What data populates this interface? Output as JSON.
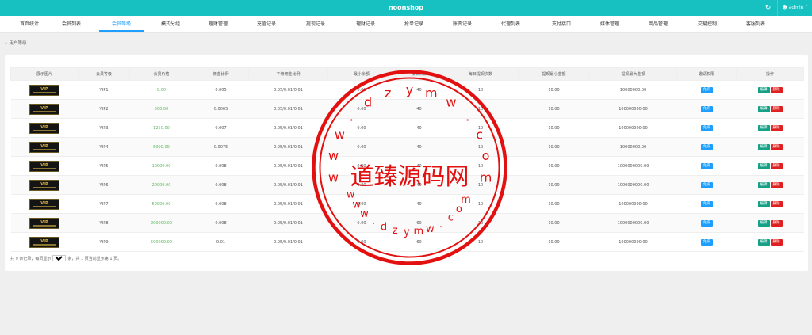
{
  "header": {
    "app_title": "noonshop",
    "refresh_icon": "refresh-icon",
    "user_label": "admin"
  },
  "nav": {
    "items": [
      {
        "label": "首页统计"
      },
      {
        "label": "会员列表"
      },
      {
        "label": "会员等级",
        "active": true
      },
      {
        "label": "模式分组"
      },
      {
        "label": "理财管理"
      },
      {
        "label": "充值记录"
      },
      {
        "label": "提现记录"
      },
      {
        "label": "理财记录"
      },
      {
        "label": "抢单记录"
      },
      {
        "label": "账变记录"
      },
      {
        "label": "代理列表"
      },
      {
        "label": "支付接口"
      },
      {
        "label": "媒体管理"
      },
      {
        "label": "商品管理"
      },
      {
        "label": "交易控制"
      },
      {
        "label": "客服列表"
      }
    ]
  },
  "breadcrumb": {
    "current": "用户等级"
  },
  "table": {
    "columns": [
      "展示图片",
      "会员等级",
      "会员价格",
      "佣金比例",
      "下级佣金比例",
      "最小余额",
      "接单次数",
      "每日提现次数",
      "提现最小金额",
      "提现最大金额",
      "邀请权限",
      "操作"
    ],
    "thumb_text": "VIP",
    "rows": [
      {
        "level": "VIP1",
        "price": "0.00",
        "commission": "0.005",
        "sub_commission": "0.05/0.01/0.01",
        "min_balance": "0.00",
        "orders": "40",
        "daily_withdraw": "10",
        "withdraw_min": "10.00",
        "withdraw_max": "10000000.00"
      },
      {
        "level": "VIP2",
        "price": "500.00",
        "commission": "0.0065",
        "sub_commission": "0.05/0.01/0.01",
        "min_balance": "0.00",
        "orders": "40",
        "daily_withdraw": "10",
        "withdraw_min": "10.00",
        "withdraw_max": "100000000.00"
      },
      {
        "level": "VIP3",
        "price": "1250.00",
        "commission": "0.007",
        "sub_commission": "0.05/0.01/0.01",
        "min_balance": "0.00",
        "orders": "40",
        "daily_withdraw": "10",
        "withdraw_min": "10.00",
        "withdraw_max": "100000000.00"
      },
      {
        "level": "VIP4",
        "price": "5000.00",
        "commission": "0.0075",
        "sub_commission": "0.05/0.01/0.01",
        "min_balance": "0.00",
        "orders": "40",
        "daily_withdraw": "10",
        "withdraw_min": "10.00",
        "withdraw_max": "10000000.00"
      },
      {
        "level": "VIP5",
        "price": "10000.00",
        "commission": "0.008",
        "sub_commission": "0.05/0.01/0.01",
        "min_balance": "0.00",
        "orders": "40",
        "daily_withdraw": "10",
        "withdraw_min": "10.00",
        "withdraw_max": "1000000000.00"
      },
      {
        "level": "VIP6",
        "price": "20000.00",
        "commission": "0.008",
        "sub_commission": "0.05/0.01/0.01",
        "min_balance": "0.00",
        "orders": "40",
        "daily_withdraw": "10",
        "withdraw_min": "10.00",
        "withdraw_max": "1000000000.00"
      },
      {
        "level": "VIP7",
        "price": "50000.00",
        "commission": "0.008",
        "sub_commission": "0.05/0.01/0.01",
        "min_balance": "0.00",
        "orders": "40",
        "daily_withdraw": "10",
        "withdraw_min": "10.00",
        "withdraw_max": "100000000.00"
      },
      {
        "level": "VIP8",
        "price": "200000.00",
        "commission": "0.008",
        "sub_commission": "0.05/0.01/0.01",
        "min_balance": "0.00",
        "orders": "60",
        "daily_withdraw": "10",
        "withdraw_min": "10.00",
        "withdraw_max": "1000000000.00"
      },
      {
        "level": "VIP9",
        "price": "500000.00",
        "commission": "0.01",
        "sub_commission": "0.05/0.01/0.01",
        "min_balance": "0.00",
        "orders": "60",
        "daily_withdraw": "10",
        "withdraw_min": "10.00",
        "withdraw_max": "100000000.00"
      }
    ],
    "invite_label": "允许",
    "edit_label": "编辑",
    "delete_label": "删除"
  },
  "pager": {
    "prefix": "共 9 条记录，每页显示",
    "page_size": "20",
    "suffix": "条，共 1 页当前显示第 1 页。"
  },
  "watermark": {
    "url_top": "www.dzymw.com",
    "url_bottom": "www.dzymw.com",
    "center_text": "道臻源码网",
    "color": "#e31010"
  }
}
